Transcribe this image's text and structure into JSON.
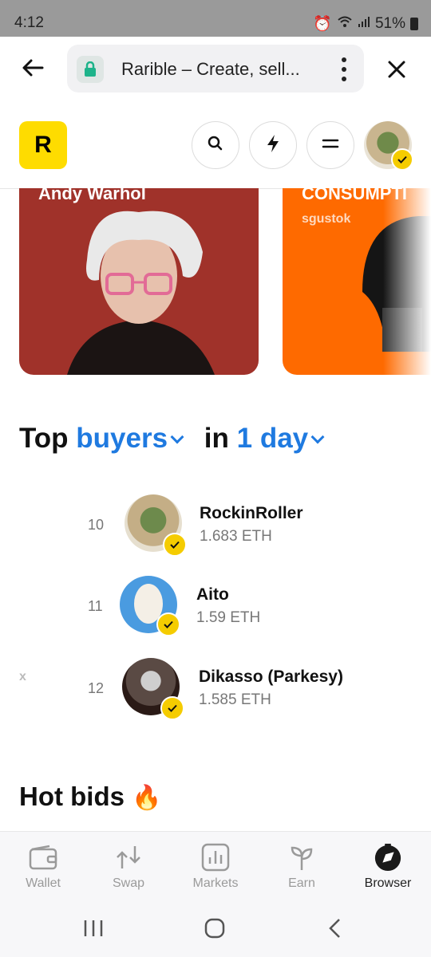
{
  "status": {
    "time": "4:12",
    "battery": "51%"
  },
  "browser": {
    "url_title": "Rarible – Create, sell...",
    "back": "back-arrow-icon",
    "close": "close-icon",
    "lock": "lock-icon"
  },
  "site": {
    "logo_letter": "R",
    "avatar": "avatar-icon",
    "buttons": [
      "search-icon",
      "lightning-icon",
      "menu-icon"
    ]
  },
  "featured": [
    {
      "title": "Andy Warhol",
      "subtitle": ""
    },
    {
      "title": "CONSUMPTI",
      "subtitle": "sgustok"
    }
  ],
  "top_buyers": {
    "heading_prefix": "Top",
    "category": "buyers",
    "in_word": "in",
    "period": "1 day",
    "side_mark": "x",
    "rows": [
      {
        "rank": "10",
        "name": "RockinRoller",
        "amount": "1.683 ETH"
      },
      {
        "rank": "11",
        "name": "Aito",
        "amount": "1.59 ETH"
      },
      {
        "rank": "12",
        "name": "Dikasso (Parkesy)",
        "amount": "1.585 ETH"
      }
    ]
  },
  "hot_bids": {
    "title": "Hot bids",
    "emoji": "🔥"
  },
  "bottom_nav": [
    {
      "label": "Wallet",
      "icon": "wallet-icon",
      "active": false
    },
    {
      "label": "Swap",
      "icon": "swap-icon",
      "active": false
    },
    {
      "label": "Markets",
      "icon": "markets-icon",
      "active": false
    },
    {
      "label": "Earn",
      "icon": "earn-icon",
      "active": false
    },
    {
      "label": "Browser",
      "icon": "browser-icon",
      "active": true
    }
  ],
  "colors": {
    "accent": "#1f7ae0",
    "logo_bg": "#fedc00",
    "card1_bg": "#a0322a",
    "card2_bg": "#fe6a00",
    "badge": "#f5cc00"
  }
}
